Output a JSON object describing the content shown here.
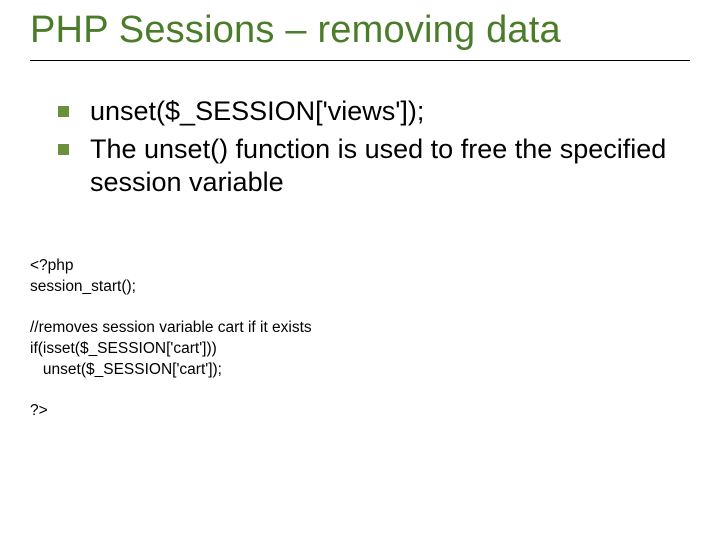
{
  "title": "PHP Sessions – removing data",
  "bullets": [
    "unset($_SESSION['views']);",
    "The unset() function is used to free the specified session variable"
  ],
  "code1": "<?php\nsession_start();",
  "code2": "//removes session variable cart if it exists\nif(isset($_SESSION['cart']))\n   unset($_SESSION['cart']);",
  "code3": "?>"
}
